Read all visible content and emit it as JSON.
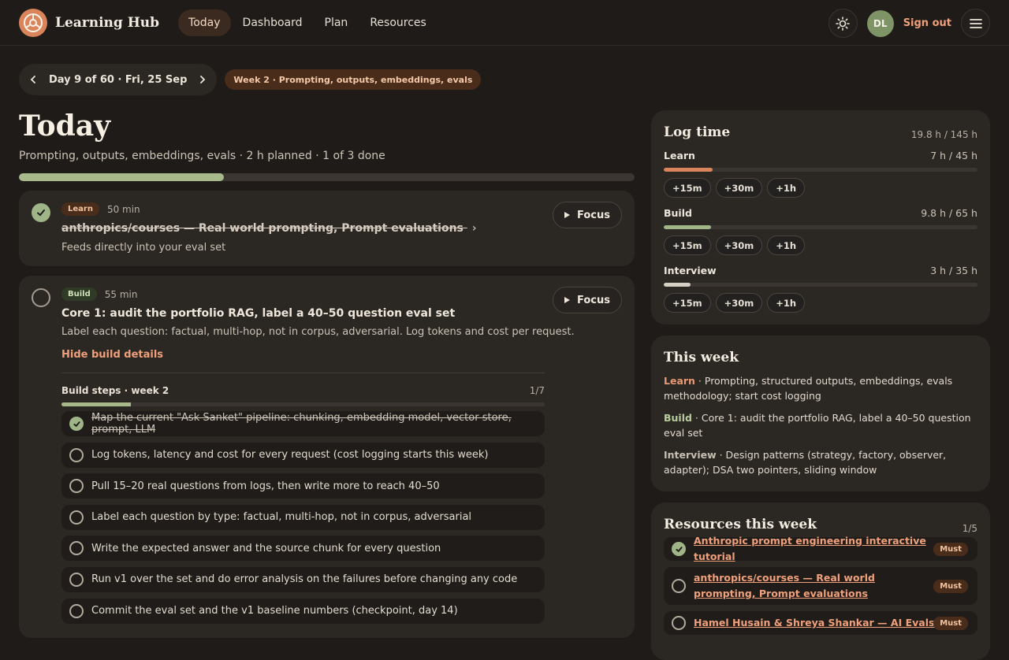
{
  "header": {
    "brand": "Learning Hub",
    "nav": [
      "Today",
      "Dashboard",
      "Plan",
      "Resources"
    ],
    "avatar_initials": "DL",
    "sign_out": "Sign out"
  },
  "daybar": {
    "label": "Day 9 of 60 · Fri, 25 Sep",
    "week_badge": "Week 2 · Prompting, outputs, embeddings, evals"
  },
  "today": {
    "title": "Today",
    "subtitle": "Prompting, outputs, embeddings, evals · 2 h planned · 1 of 3 done",
    "progress_fraction": 0.333
  },
  "tasks": [
    {
      "tag": "Learn",
      "duration": "50 min",
      "title": "anthropics/courses — Real world prompting, Prompt evaluations",
      "desc": "Feeds directly into your eval set",
      "focus": "Focus",
      "done": true
    },
    {
      "tag": "Build",
      "duration": "55 min",
      "title": "Core 1: audit the portfolio RAG, label a 40–50 question eval set",
      "desc": "Label each question: factual, multi-hop, not in corpus, adversarial. Log tokens and cost per request.",
      "focus": "Focus",
      "done": false,
      "hide_link": "Hide build details",
      "steps_title": "Build steps · week 2",
      "steps_count": "1/7",
      "steps_fraction": 0.143,
      "steps": [
        {
          "text": "Map the current \"Ask Sanket\" pipeline: chunking, embedding model, vector store, prompt, LLM",
          "done": true
        },
        {
          "text": "Log tokens, latency and cost for every request (cost logging starts this week)",
          "done": false
        },
        {
          "text": "Pull 15–20 real questions from logs, then write more to reach 40–50",
          "done": false
        },
        {
          "text": "Label each question by type: factual, multi-hop, not in corpus, adversarial",
          "done": false
        },
        {
          "text": "Write the expected answer and the source chunk for every question",
          "done": false
        },
        {
          "text": "Run v1 over the set and do error analysis on the failures before changing any code",
          "done": false
        },
        {
          "text": "Commit the eval set and the v1 baseline numbers (checkpoint, day 14)",
          "done": false
        }
      ]
    }
  ],
  "log_time": {
    "title": "Log time",
    "total": "19.8 h / 145 h",
    "increments": [
      "+15m",
      "+30m",
      "+1h"
    ],
    "rows": [
      {
        "name": "Learn",
        "value": "7 h / 45 h",
        "fraction": 0.156,
        "color": "#d9845a"
      },
      {
        "name": "Build",
        "value": "9.8 h / 65 h",
        "fraction": 0.151,
        "color": "#9fb487"
      },
      {
        "name": "Interview",
        "value": "3 h / 35 h",
        "fraction": 0.086,
        "color": "#d6cfc4"
      }
    ]
  },
  "this_week": {
    "title": "This week",
    "learn_key": "Learn",
    "learn": " · Prompting, structured outputs, embeddings, evals methodology; start cost logging",
    "build_key": "Build",
    "build": " · Core 1: audit the portfolio RAG, label a 40–50 question eval set",
    "interview_key": "Interview",
    "interview": " · Design patterns (strategy, factory, observer, adapter); DSA two pointers, sliding window"
  },
  "resources": {
    "title": "Resources this week",
    "count": "1/5",
    "items": [
      {
        "text": "Anthropic prompt engineering interactive tutorial",
        "badge": "Must",
        "done": true
      },
      {
        "text": "anthropics/courses — Real world prompting, Prompt evaluations",
        "badge": "Must",
        "done": false
      },
      {
        "text": "Hamel Husain & Shreya Shankar — AI Evals FAQ",
        "badge": "Must",
        "done": false
      }
    ]
  },
  "icons": {
    "logo": "learning-hub-logo",
    "theme": "sun-icon",
    "menu": "hamburger-menu-icon",
    "prev": "chevron-left-icon",
    "next": "chevron-right-icon",
    "play": "play-icon",
    "check": "check-icon"
  }
}
